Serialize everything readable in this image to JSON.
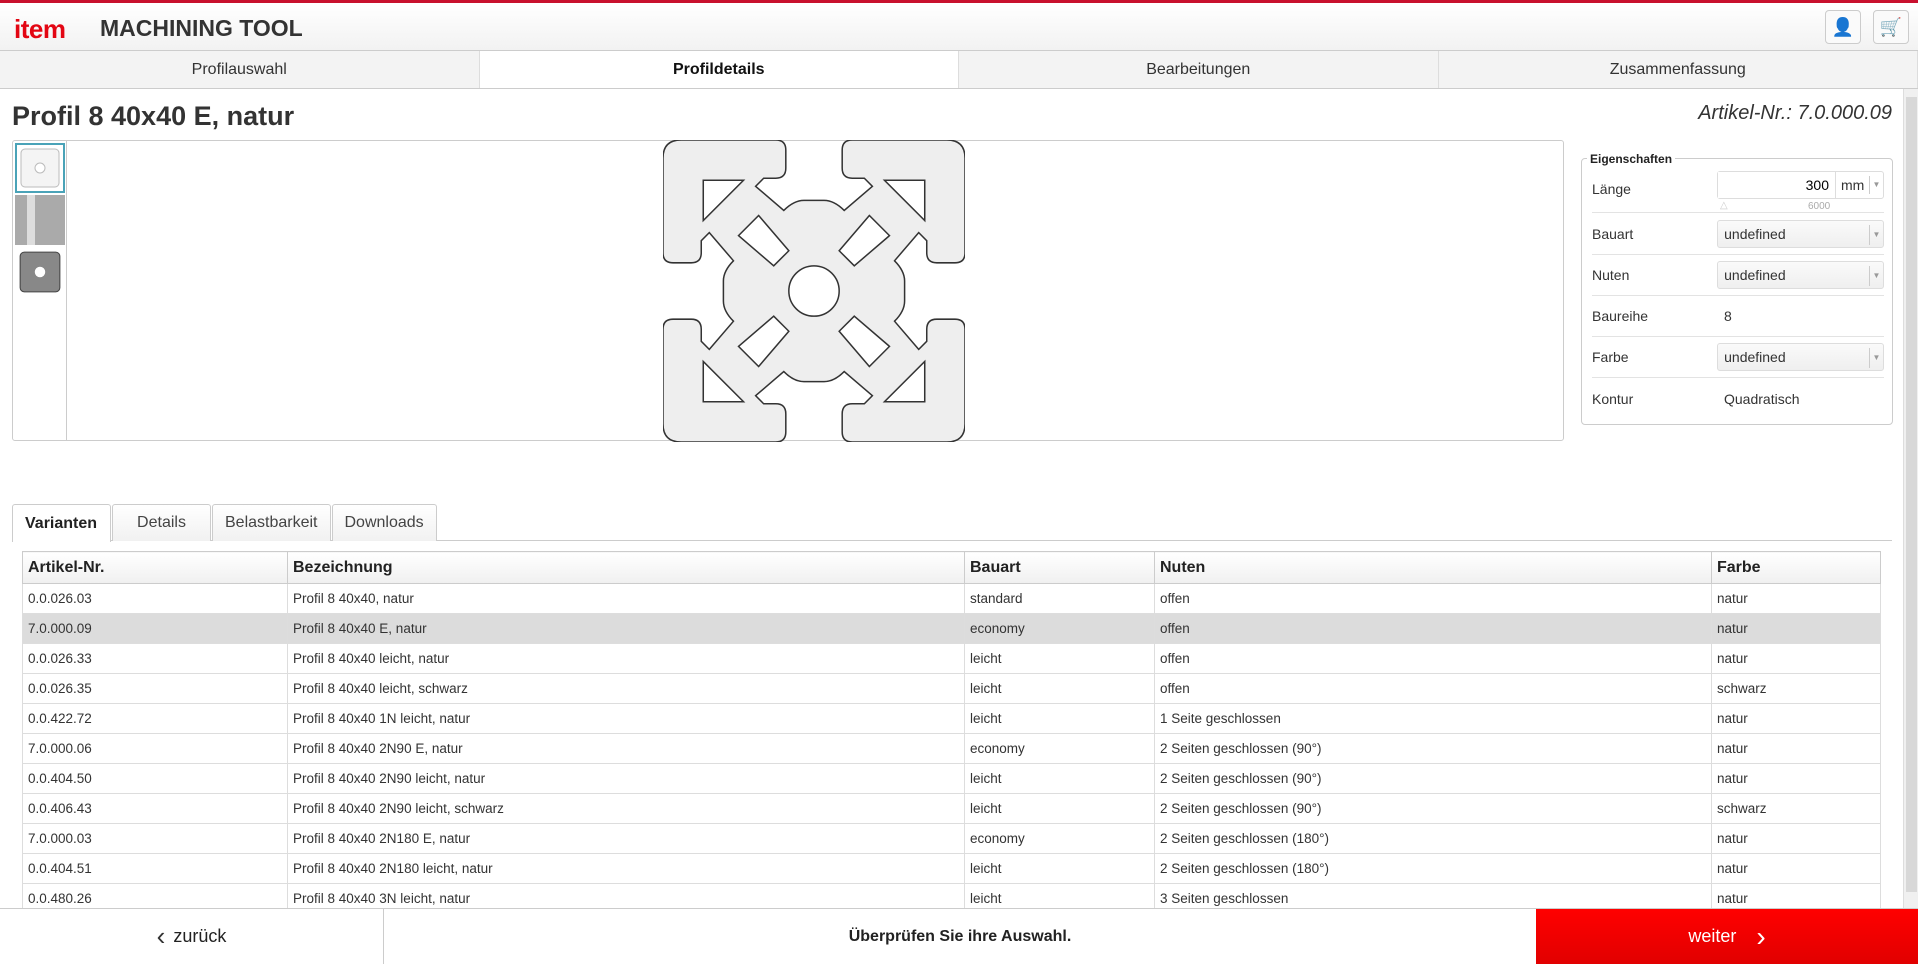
{
  "header": {
    "logo": "item",
    "title": "MACHINING TOOL",
    "user_icon": "user-icon",
    "cart_icon": "cart-icon"
  },
  "steps": [
    "Profilauswahl",
    "Profildetails",
    "Bearbeitungen",
    "Zusammenfassung"
  ],
  "active_step": 1,
  "page": {
    "title": "Profil 8 40x40 E, natur",
    "artikel": "Artikel-Nr.: 7.0.000.09"
  },
  "properties": {
    "legend": "Eigenschaften",
    "laenge": {
      "label": "Länge",
      "value": "300",
      "unit": "mm",
      "max": "6000"
    },
    "bauart": {
      "label": "Bauart",
      "value": "undefined"
    },
    "nuten": {
      "label": "Nuten",
      "value": "undefined"
    },
    "baureihe": {
      "label": "Baureihe",
      "value": "8"
    },
    "farbe": {
      "label": "Farbe",
      "value": "undefined"
    },
    "kontur": {
      "label": "Kontur",
      "value": "Quadratisch"
    }
  },
  "tabs": [
    "Varianten",
    "Details",
    "Belastbarkeit",
    "Downloads"
  ],
  "table": {
    "headers": [
      "Artikel-Nr.",
      "Bezeichnung",
      "Bauart",
      "Nuten",
      "Farbe"
    ],
    "selected_row": 1,
    "rows": [
      [
        "0.0.026.03",
        "Profil 8 40x40, natur",
        "standard",
        "offen",
        "natur"
      ],
      [
        "7.0.000.09",
        "Profil 8 40x40 E, natur",
        "economy",
        "offen",
        "natur"
      ],
      [
        "0.0.026.33",
        "Profil 8 40x40 leicht, natur",
        "leicht",
        "offen",
        "natur"
      ],
      [
        "0.0.026.35",
        "Profil 8 40x40 leicht, schwarz",
        "leicht",
        "offen",
        "schwarz"
      ],
      [
        "0.0.422.72",
        "Profil 8 40x40 1N leicht, natur",
        "leicht",
        "1 Seite geschlossen",
        "natur"
      ],
      [
        "7.0.000.06",
        "Profil 8 40x40 2N90 E, natur",
        "economy",
        "2 Seiten geschlossen (90°)",
        "natur"
      ],
      [
        "0.0.404.50",
        "Profil 8 40x40 2N90 leicht, natur",
        "leicht",
        "2 Seiten geschlossen (90°)",
        "natur"
      ],
      [
        "0.0.406.43",
        "Profil 8 40x40 2N90 leicht, schwarz",
        "leicht",
        "2 Seiten geschlossen (90°)",
        "schwarz"
      ],
      [
        "7.0.000.03",
        "Profil 8 40x40 2N180 E, natur",
        "economy",
        "2 Seiten geschlossen (180°)",
        "natur"
      ],
      [
        "0.0.404.51",
        "Profil 8 40x40 2N180 leicht, natur",
        "leicht",
        "2 Seiten geschlossen (180°)",
        "natur"
      ],
      [
        "0.0.480.26",
        "Profil 8 40x40 3N leicht, natur",
        "leicht",
        "3 Seiten geschlossen",
        "natur"
      ]
    ]
  },
  "footer": {
    "back": "zurück",
    "message": "Überprüfen Sie ihre Auswahl.",
    "next": "weiter"
  },
  "colors": {
    "brand": "#e30613",
    "next_button": "#ff0000",
    "selected_row": "#dcdcdc"
  }
}
